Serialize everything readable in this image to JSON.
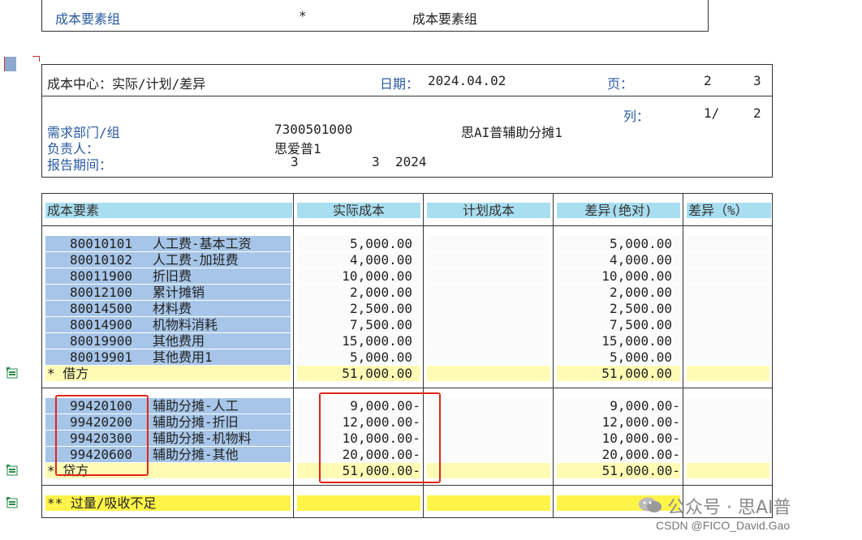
{
  "top_box": {
    "label": "成本要素组",
    "star": "*",
    "value": "成本要素组"
  },
  "header": {
    "title": "成本中心：实际/计划/差异",
    "date_label": "日期：",
    "date_value": "2024.04.02",
    "page_label": "页：",
    "page_current": "2",
    "page_total": "3"
  },
  "info": {
    "col_label": "列：",
    "col_current": "1/",
    "col_total": "2",
    "dept_label": "需求部门/组",
    "dept_code": "7300501000",
    "dept_name": "思AI普辅助分摊1",
    "owner_label": "负责人：",
    "owner_value": "思爱普1",
    "period_label": "报告期间：",
    "period_from": "3",
    "period_to": "3",
    "period_year": "2024"
  },
  "columns": {
    "element": "成本要素",
    "actual": "实际成本",
    "plan": "计划成本",
    "var_abs": "差异(绝对)",
    "var_pct": "差异（%）"
  },
  "debit_rows": [
    {
      "code": "80010101",
      "name": "人工费-基本工资",
      "actual": "5,000.00",
      "variance": "5,000.00"
    },
    {
      "code": "80010102",
      "name": "人工费-加班费",
      "actual": "4,000.00",
      "variance": "4,000.00"
    },
    {
      "code": "80011900",
      "name": "折旧费",
      "actual": "10,000.00",
      "variance": "10,000.00"
    },
    {
      "code": "80012100",
      "name": "累计摊销",
      "actual": "2,000.00",
      "variance": "2,000.00"
    },
    {
      "code": "80014500",
      "name": "材料费",
      "actual": "2,500.00",
      "variance": "2,500.00"
    },
    {
      "code": "80014900",
      "name": "机物料消耗",
      "actual": "7,500.00",
      "variance": "7,500.00"
    },
    {
      "code": "80019900",
      "name": "其他费用",
      "actual": "15,000.00",
      "variance": "15,000.00"
    },
    {
      "code": "80019901",
      "name": "其他费用1",
      "actual": "5,000.00",
      "variance": "5,000.00"
    }
  ],
  "debit_total": {
    "label": "*  借方",
    "actual": "51,000.00",
    "variance": "51,000.00"
  },
  "credit_rows": [
    {
      "code": "99420100",
      "name": "辅助分摊-人工",
      "actual": "9,000.00-",
      "variance": "9,000.00-"
    },
    {
      "code": "99420200",
      "name": "辅助分摊-折旧",
      "actual": "12,000.00-",
      "variance": "12,000.00-"
    },
    {
      "code": "99420300",
      "name": "辅助分摊-机物料",
      "actual": "10,000.00-",
      "variance": "10,000.00-"
    },
    {
      "code": "99420600",
      "name": "辅助分摊-其他",
      "actual": "20,000.00-",
      "variance": "20,000.00-"
    }
  ],
  "credit_total": {
    "label": "*  贷方",
    "actual": "51,000.00-",
    "variance": "51,000.00-"
  },
  "grand_total": {
    "label": "** 过量/吸收不足"
  },
  "watermark": {
    "line1": "公众号 · 思AI普",
    "line2": "CSDN @FICO_David.Gao"
  },
  "colors": {
    "header_bg": "#a8def0",
    "account_bg": "#a6c5e8",
    "subtotal_bg": "#fffbb4",
    "total_bg": "#fff44a",
    "highlight": "#e0261c"
  }
}
